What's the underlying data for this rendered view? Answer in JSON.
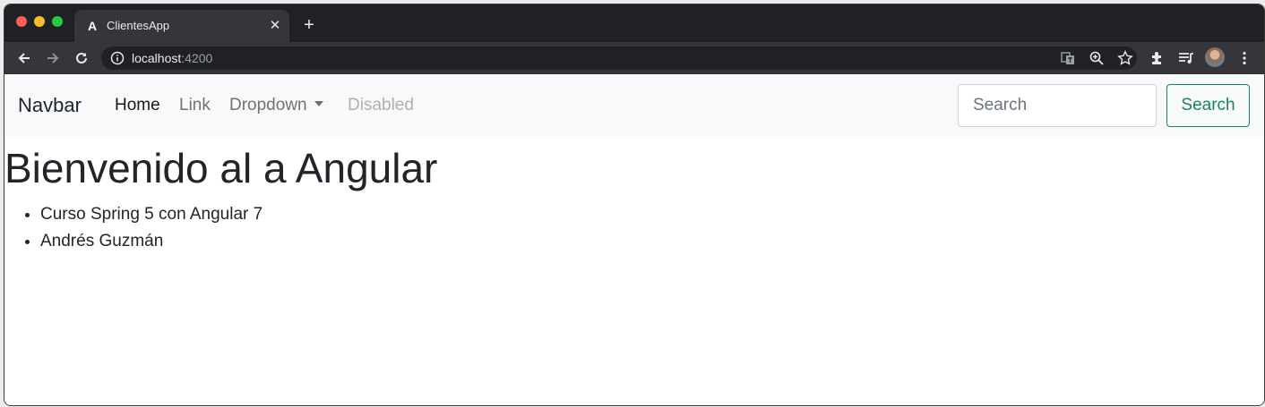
{
  "browser": {
    "tab": {
      "title": "ClientesApp",
      "favicon": "angular-logo-icon",
      "close_symbol": "✕"
    },
    "new_tab_symbol": "+",
    "url": {
      "host": "localhost",
      "port": ":4200"
    },
    "toolbar_icons": [
      "back-icon",
      "forward-icon",
      "reload-icon",
      "info-icon",
      "translate-icon",
      "zoom-icon",
      "bookmark-star-icon",
      "extensions-icon",
      "reading-list-icon",
      "profile-avatar",
      "menu-icon"
    ]
  },
  "navbar": {
    "brand": "Navbar",
    "links": [
      {
        "label": "Home",
        "state": "active"
      },
      {
        "label": "Link",
        "state": "normal"
      },
      {
        "label": "Dropdown",
        "state": "normal"
      },
      {
        "label": "Disabled",
        "state": "disabled"
      }
    ],
    "search": {
      "placeholder": "Search",
      "value": "",
      "button_label": "Search"
    }
  },
  "main": {
    "heading": "Bienvenido al a Angular",
    "items": [
      "Curso Spring 5 con Angular 7",
      "Andrés Guzmán"
    ]
  },
  "colors": {
    "navbar_bg": "#f8f9fa",
    "success": "#198754",
    "text": "#212529",
    "chrome_dark": "#202124",
    "chrome_toolbar": "#35363a"
  }
}
